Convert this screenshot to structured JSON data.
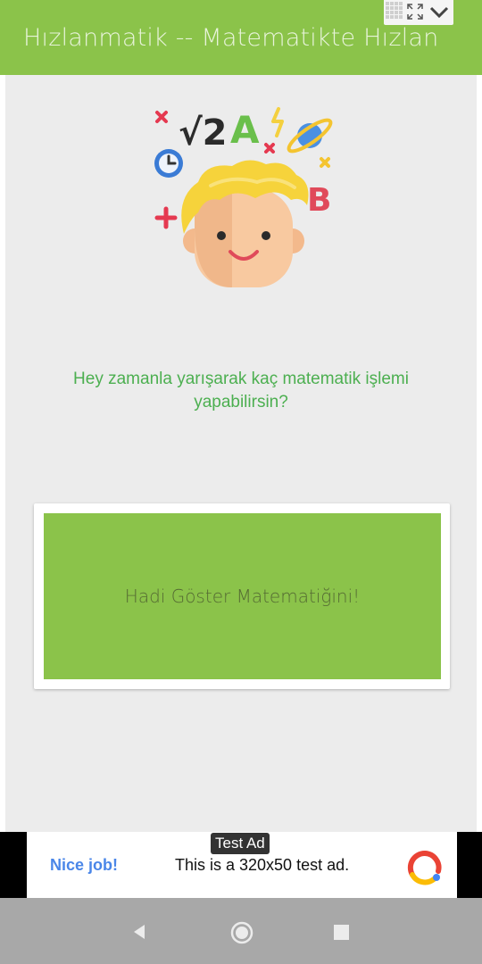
{
  "appbar": {
    "title": "Hızlanmatik -- Matematikte Hızlan"
  },
  "main": {
    "question": "Hey zamanla yarışarak kaç matematik işlemi yapabilirsin?",
    "start_button": "Hadi Göster Matematiğini!"
  },
  "hero": {
    "root_symbol": "√2",
    "letter_a": "A",
    "letter_b": "B"
  },
  "ad": {
    "tag": "Test Ad",
    "left_label": "Nice job!",
    "text": "This is a 320x50 test ad."
  },
  "colors": {
    "appbar": "#8bc34a",
    "background": "#ececec",
    "question_text": "#4caf50",
    "button": "#8bc34a",
    "ad_link": "#4a86e8"
  },
  "icons": {
    "system_widget": [
      "grid-icon",
      "expand-icon",
      "chevron-down-icon"
    ],
    "hero": "thinking-kid-illustration",
    "ad_logo": "admob-logo-icon",
    "navigation": [
      "back-icon",
      "home-icon",
      "recents-icon"
    ]
  }
}
